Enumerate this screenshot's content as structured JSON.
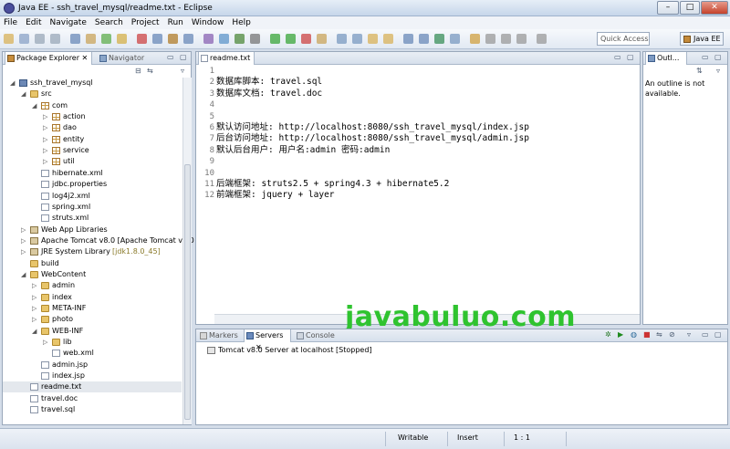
{
  "window": {
    "title": "Java EE - ssh_travel_mysql/readme.txt - Eclipse"
  },
  "menu": [
    "File",
    "Edit",
    "Navigate",
    "Search",
    "Project",
    "Run",
    "Window",
    "Help"
  ],
  "toolbar": {
    "quick_access_placeholder": "Quick Access",
    "perspective": "Java EE"
  },
  "package_explorer": {
    "tabs": [
      "Package Explorer",
      "Navigator"
    ],
    "tree": [
      {
        "label": "ssh_travel_mysql",
        "type": "proj",
        "depth": 0,
        "arrow": "▴"
      },
      {
        "label": "src",
        "type": "folder",
        "depth": 1,
        "arrow": "▴"
      },
      {
        "label": "com",
        "type": "pkg",
        "depth": 2,
        "arrow": "▴"
      },
      {
        "label": "action",
        "type": "pkg",
        "depth": 3,
        "arrow": "▸"
      },
      {
        "label": "dao",
        "type": "pkg",
        "depth": 3,
        "arrow": "▸"
      },
      {
        "label": "entity",
        "type": "pkg",
        "depth": 3,
        "arrow": "▸"
      },
      {
        "label": "service",
        "type": "pkg",
        "depth": 3,
        "arrow": "▸"
      },
      {
        "label": "util",
        "type": "pkg",
        "depth": 3,
        "arrow": "▸"
      },
      {
        "label": "hibernate.xml",
        "type": "file",
        "depth": 2,
        "arrow": ""
      },
      {
        "label": "jdbc.properties",
        "type": "file",
        "depth": 2,
        "arrow": ""
      },
      {
        "label": "log4j2.xml",
        "type": "file",
        "depth": 2,
        "arrow": ""
      },
      {
        "label": "spring.xml",
        "type": "file",
        "depth": 2,
        "arrow": ""
      },
      {
        "label": "struts.xml",
        "type": "file",
        "depth": 2,
        "arrow": ""
      },
      {
        "label": "Web App Libraries",
        "type": "lib",
        "depth": 1,
        "arrow": "▸"
      },
      {
        "label": "Apache Tomcat v8.0 [Apache Tomcat v8.0",
        "type": "lib",
        "depth": 1,
        "arrow": "▸"
      },
      {
        "label": "JRE System Library",
        "label_extra": " [jdk1.8.0_45]",
        "type": "lib",
        "depth": 1,
        "arrow": "▸"
      },
      {
        "label": "build",
        "type": "folder",
        "depth": 1,
        "arrow": ""
      },
      {
        "label": "WebContent",
        "type": "folder",
        "depth": 1,
        "arrow": "▴"
      },
      {
        "label": "admin",
        "type": "folder",
        "depth": 2,
        "arrow": "▸"
      },
      {
        "label": "index",
        "type": "folder",
        "depth": 2,
        "arrow": "▸"
      },
      {
        "label": "META-INF",
        "type": "folder",
        "depth": 2,
        "arrow": "▸"
      },
      {
        "label": "photo",
        "type": "folder",
        "depth": 2,
        "arrow": "▸"
      },
      {
        "label": "WEB-INF",
        "type": "folder",
        "depth": 2,
        "arrow": "▴"
      },
      {
        "label": "lib",
        "type": "folder",
        "depth": 3,
        "arrow": "▸"
      },
      {
        "label": "web.xml",
        "type": "file",
        "depth": 3,
        "arrow": ""
      },
      {
        "label": "admin.jsp",
        "type": "file",
        "depth": 2,
        "arrow": ""
      },
      {
        "label": "index.jsp",
        "type": "file",
        "depth": 2,
        "arrow": ""
      },
      {
        "label": "readme.txt",
        "type": "file",
        "depth": 1,
        "arrow": "",
        "selected": true
      },
      {
        "label": "travel.doc",
        "type": "file",
        "depth": 1,
        "arrow": ""
      },
      {
        "label": "travel.sql",
        "type": "file",
        "depth": 1,
        "arrow": ""
      }
    ]
  },
  "editor": {
    "tab": "readme.txt",
    "lines": [
      "",
      "数据库脚本: travel.sql",
      "数据库文档: travel.doc",
      "",
      "",
      "默认访问地址: http://localhost:8080/ssh_travel_mysql/index.jsp",
      "后台访问地址: http://localhost:8080/ssh_travel_mysql/admin.jsp",
      "默认后台用户: 用户名:admin 密码:admin",
      "",
      "",
      "后端框架: struts2.5 + spring4.3 + hibernate5.2",
      "前端框架: jquery + layer"
    ]
  },
  "outline": {
    "tab": "Outl...",
    "message": "An outline is not available."
  },
  "bottom": {
    "tabs": [
      "Markers",
      "Servers",
      "Console"
    ],
    "server": "Tomcat v8.0 Server at localhost  [Stopped]"
  },
  "watermark": "javabuluo.com",
  "status": {
    "mode": "Writable",
    "insert": "Insert",
    "position": "1 : 1"
  },
  "colors": {
    "accent": "#2fc32f",
    "jdk": "#8a7a2a"
  }
}
